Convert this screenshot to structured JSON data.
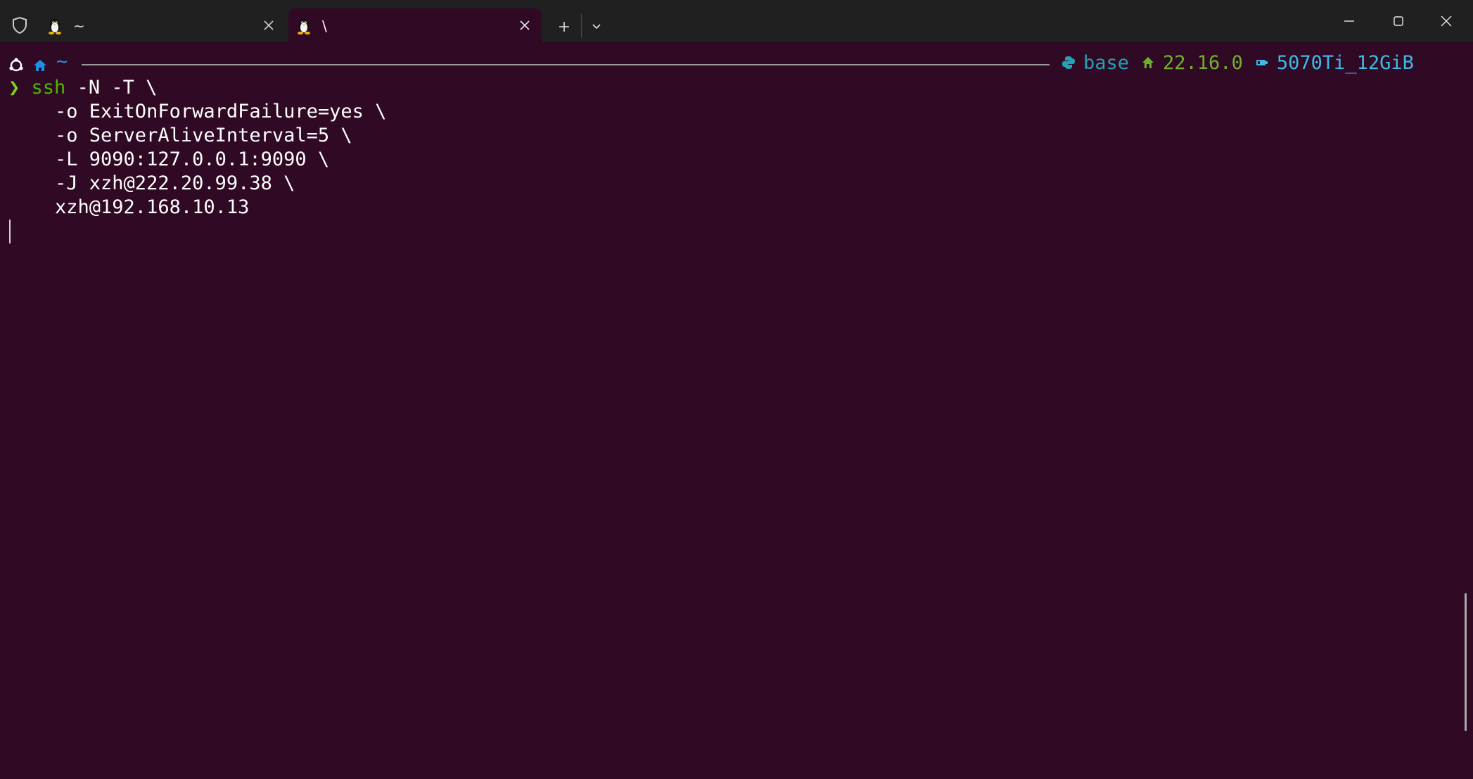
{
  "window": {
    "tabs": [
      {
        "title": "~",
        "icon": "linux-tux-icon",
        "active": false
      },
      {
        "title": "\\",
        "icon": "linux-tux-icon",
        "active": true
      }
    ],
    "new_tab_glyph": "+",
    "dropdown_glyph": "⌄"
  },
  "prompt": {
    "cwd": "~",
    "conda_env": "base",
    "node_version": "22.16.0",
    "gpu": "5070Ti_12GiB",
    "chevron": "❯"
  },
  "terminal": {
    "command": "ssh",
    "first_args": " -N -T \\",
    "lines": [
      "    -o ExitOnForwardFailure=yes \\",
      "    -o ServerAliveInterval=5 \\",
      "    -L 9090:127.0.0.1:9090 \\",
      "    -J xzh@222.20.99.38 \\",
      "    xzh@192.168.10.13"
    ]
  },
  "colors": {
    "background": "#300a24",
    "titlebar": "#202020",
    "prompt_green": "#7ed321",
    "command_green": "#4db800",
    "conda_teal": "#22a2b4",
    "node_green": "#6fb12c",
    "gpu_blue": "#3fb9e6",
    "home_blue": "#1e90e6"
  }
}
